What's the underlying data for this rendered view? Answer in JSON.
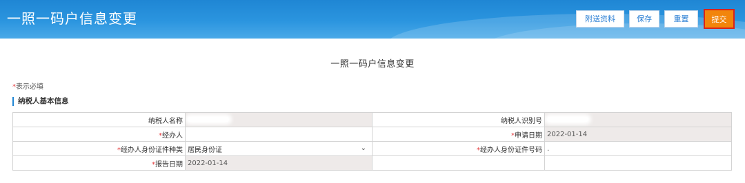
{
  "header": {
    "title": "一照一码户信息变更",
    "buttons": {
      "attach": "附送资料",
      "save": "保存",
      "reset": "重置",
      "submit": "提交"
    }
  },
  "form": {
    "title": "一照一码户信息变更",
    "required_star": "*",
    "required_note": "表示必填",
    "section_title": "纳税人基本信息",
    "fields": {
      "taxpayer_name": {
        "label": "纳税人名称",
        "value": ""
      },
      "taxpayer_id": {
        "label": "纳税人识别号",
        "value": ""
      },
      "handler": {
        "label": "经办人",
        "value": ""
      },
      "apply_date": {
        "label": "申请日期",
        "value": "2022-01-14"
      },
      "handler_id_type": {
        "label": "经办人身份证件种类",
        "value": "居民身份证"
      },
      "handler_id_number": {
        "label": "经办人身份证件号码",
        "value": "."
      },
      "report_date": {
        "label": "报告日期",
        "value": "2022-01-14"
      }
    }
  },
  "colors": {
    "header_blue": "#1f86d4",
    "submit_orange": "#f2850b",
    "submit_border": "#d8231c",
    "required_red": "#e4393c",
    "readonly_gray": "#eeeae9"
  }
}
